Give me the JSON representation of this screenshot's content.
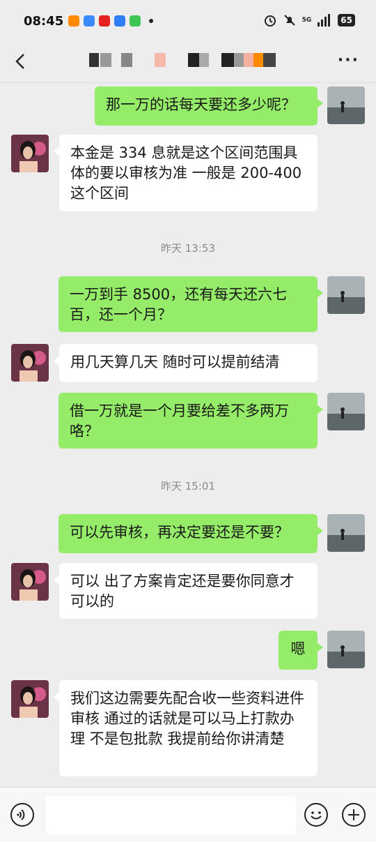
{
  "status_bar": {
    "time": "08:45",
    "battery": "65",
    "network": "5G"
  },
  "header": {
    "back_label": "‹",
    "more_label": "···"
  },
  "messages": [
    {
      "sender": "self",
      "text": "那一万的话每天要还多少呢？"
    },
    {
      "sender": "other",
      "text": "本金是 334 息就是这个区间范围具体的要以审核为准 一般是 200-400 这个区间"
    },
    {
      "timestamp": "昨天 13:53"
    },
    {
      "sender": "self",
      "text": "一万到手 8500，还有每天还六七百，还一个月？"
    },
    {
      "sender": "other",
      "text": "用几天算几天 随时可以提前结清"
    },
    {
      "sender": "self",
      "text": "借一万就是一个月要给差不多两万咯？"
    },
    {
      "timestamp": "昨天 15:01"
    },
    {
      "sender": "self",
      "text": "可以先审核，再决定要还是不要？"
    },
    {
      "sender": "other",
      "text": "可以 出了方案肯定还是要你同意才可以的"
    },
    {
      "sender": "self",
      "text": "嗯"
    },
    {
      "sender": "other",
      "text": "我们这边需要先配合收一些资料进件审核 通过的话就是可以马上打款办理 不是包批款 我提前给你讲清楚"
    }
  ],
  "input": {
    "value": ""
  },
  "icons": {
    "voice": "voice-icon",
    "emoji": "emoji-icon",
    "plus": "plus-icon",
    "back": "back-arrow-icon",
    "more": "more-icon"
  },
  "colors": {
    "self_bubble": "#95ec69",
    "other_bubble": "#ffffff",
    "background": "#ededed"
  }
}
